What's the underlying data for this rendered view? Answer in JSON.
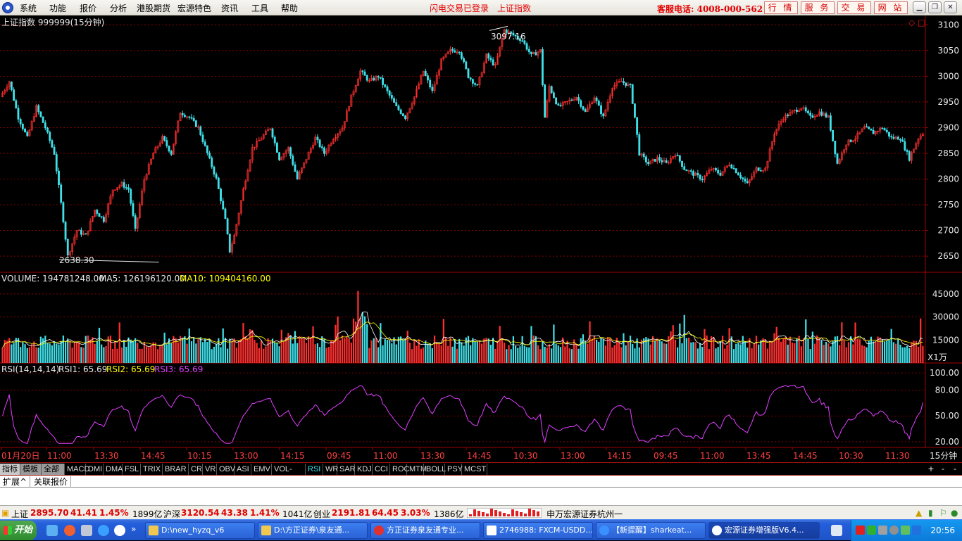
{
  "menubar": {
    "items": [
      "系统",
      "功能",
      "报价",
      "分析",
      "港股期货",
      "宏源特色",
      "资讯",
      "工具",
      "帮助"
    ],
    "flash_status": "闪电交易已登录",
    "index_name": "上证指数",
    "hotline": "客服电话: 4008-000-562",
    "nav_buttons": [
      "行 情",
      "服 务",
      "交 易",
      "网 站"
    ]
  },
  "chart": {
    "title": "上证指数 999999(15分钟)",
    "high_label": "3097.16",
    "low_label": "2638.30",
    "price_ticks": [
      "3100",
      "3050",
      "3000",
      "2950",
      "2900",
      "2850",
      "2800",
      "2750",
      "2700",
      "2650"
    ],
    "volume": {
      "label": "VOLUME: 194781248.00",
      "ma5": "MA5: 126196120.00",
      "ma10": "MA10: 109404160.00",
      "ticks": [
        "45000",
        "30000",
        "15000"
      ],
      "unit": "X1万"
    },
    "rsi": {
      "label": "RSI(14,14,14)",
      "rsi1": "RSI1: 65.69",
      "rsi2": "RSI2: 65.69",
      "rsi3": "RSI3: 65.69",
      "ticks": [
        "100.00",
        "80.00",
        "50.00",
        "20.00"
      ]
    },
    "time_axis": [
      "01月20日",
      "11:00",
      "13:30",
      "14:45",
      "10:15",
      "13:00",
      "14:15",
      "09:45",
      "11:00",
      "13:30",
      "14:45",
      "10:30",
      "13:00",
      "14:15",
      "09:45",
      "11:00",
      "13:45",
      "14:45",
      "10:30",
      "11:30"
    ],
    "period": "15分钟",
    "colors": {
      "up": "#ff3030",
      "down": "#40e0e8",
      "rsi": "#e040ff",
      "ma5": "#ffffff",
      "ma10": "#ffff00",
      "grid": "#a00000"
    }
  },
  "chart_data": {
    "type": "candlestick",
    "title": "上证指数 999999(15分钟)",
    "ylim": [
      2620,
      3110
    ],
    "anchors": [
      [
        0,
        2960
      ],
      [
        4,
        2990
      ],
      [
        8,
        2920
      ],
      [
        12,
        2880
      ],
      [
        16,
        2940
      ],
      [
        20,
        2900
      ],
      [
        24,
        2850
      ],
      [
        28,
        2720
      ],
      [
        30,
        2650
      ],
      [
        34,
        2700
      ],
      [
        38,
        2690
      ],
      [
        42,
        2740
      ],
      [
        46,
        2720
      ],
      [
        50,
        2780
      ],
      [
        54,
        2790
      ],
      [
        57,
        2780
      ],
      [
        60,
        2700
      ],
      [
        64,
        2800
      ],
      [
        68,
        2850
      ],
      [
        72,
        2880
      ],
      [
        76,
        2850
      ],
      [
        80,
        2930
      ],
      [
        84,
        2920
      ],
      [
        88,
        2900
      ],
      [
        92,
        2850
      ],
      [
        96,
        2800
      ],
      [
        100,
        2720
      ],
      [
        102,
        2660
      ],
      [
        104,
        2690
      ],
      [
        108,
        2780
      ],
      [
        112,
        2860
      ],
      [
        116,
        2880
      ],
      [
        120,
        2900
      ],
      [
        124,
        2840
      ],
      [
        128,
        2860
      ],
      [
        132,
        2800
      ],
      [
        136,
        2840
      ],
      [
        140,
        2880
      ],
      [
        144,
        2850
      ],
      [
        148,
        2880
      ],
      [
        152,
        2900
      ],
      [
        156,
        2960
      ],
      [
        160,
        3010
      ],
      [
        164,
        2990
      ],
      [
        168,
        3000
      ],
      [
        172,
        2970
      ],
      [
        176,
        2940
      ],
      [
        180,
        2920
      ],
      [
        184,
        2960
      ],
      [
        188,
        3010
      ],
      [
        192,
        2970
      ],
      [
        196,
        3030
      ],
      [
        200,
        3050
      ],
      [
        204,
        3050
      ],
      [
        208,
        3000
      ],
      [
        212,
        2980
      ],
      [
        216,
        3040
      ],
      [
        220,
        3020
      ],
      [
        224,
        3090
      ],
      [
        228,
        3080
      ],
      [
        232,
        3070
      ],
      [
        236,
        3040
      ],
      [
        240,
        3050
      ],
      [
        242,
        2920
      ],
      [
        244,
        2980
      ],
      [
        248,
        2940
      ],
      [
        252,
        2950
      ],
      [
        256,
        2960
      ],
      [
        260,
        2930
      ],
      [
        264,
        2960
      ],
      [
        268,
        2920
      ],
      [
        272,
        2980
      ],
      [
        276,
        2990
      ],
      [
        280,
        2980
      ],
      [
        282,
        2920
      ],
      [
        284,
        2850
      ],
      [
        288,
        2830
      ],
      [
        292,
        2840
      ],
      [
        296,
        2830
      ],
      [
        300,
        2850
      ],
      [
        304,
        2820
      ],
      [
        308,
        2810
      ],
      [
        312,
        2800
      ],
      [
        316,
        2820
      ],
      [
        320,
        2810
      ],
      [
        324,
        2830
      ],
      [
        328,
        2810
      ],
      [
        332,
        2790
      ],
      [
        336,
        2820
      ],
      [
        340,
        2820
      ],
      [
        344,
        2890
      ],
      [
        348,
        2920
      ],
      [
        352,
        2930
      ],
      [
        356,
        2940
      ],
      [
        360,
        2920
      ],
      [
        364,
        2930
      ],
      [
        368,
        2920
      ],
      [
        372,
        2830
      ],
      [
        376,
        2870
      ],
      [
        380,
        2880
      ],
      [
        384,
        2900
      ],
      [
        388,
        2890
      ],
      [
        392,
        2900
      ],
      [
        396,
        2880
      ],
      [
        400,
        2880
      ],
      [
        404,
        2840
      ],
      [
        408,
        2880
      ],
      [
        410,
        2890
      ]
    ],
    "high": 3097.16,
    "low": 2638.3,
    "last_volume": 194781248.0,
    "ma5": 126196120.0,
    "ma10": 109404160.0,
    "rsi_last": 65.69
  },
  "tabs": [
    "指标",
    "模板",
    "全部",
    "MACD",
    "DMI",
    "DMA",
    "FSL",
    "TRIX",
    "BRAR",
    "CR",
    "VR",
    "OBV",
    "ASI",
    "EMV",
    "VOL-TDX",
    "RSI",
    "WR",
    "SAR",
    "KDJ",
    "CCI",
    "ROC",
    "MTM",
    "BOLL",
    "PSY",
    "MCST"
  ],
  "active_tab": "RSI",
  "extension": [
    "扩展^",
    "关联报价"
  ],
  "status": {
    "sh_name": "上证",
    "sh_val": "2895.70",
    "sh_chg": "41.41",
    "sh_pct": "1.45%",
    "sh_amt": "1899亿",
    "hs_name": "沪深",
    "hs_val": "3120.54",
    "hs_chg": "43.38",
    "hs_pct": "1.41%",
    "hs_amt": "1041亿",
    "cy_name": "创业",
    "cy_val": "2191.81",
    "cy_chg": "64.45",
    "cy_pct": "3.03%",
    "cy_amt": "1386亿",
    "broker": "申万宏源证券杭州一"
  },
  "taskbar": {
    "start": "开始",
    "tasks": [
      "D:\\new_hyzq_v6",
      "D:\\方正证券\\泉友通...",
      "方正证券泉友通专业...",
      "2746988: FXCM-USDD...",
      "【新提醒】sharkeat...",
      "宏源证券增强版V6.4..."
    ],
    "clock": "20:56"
  }
}
